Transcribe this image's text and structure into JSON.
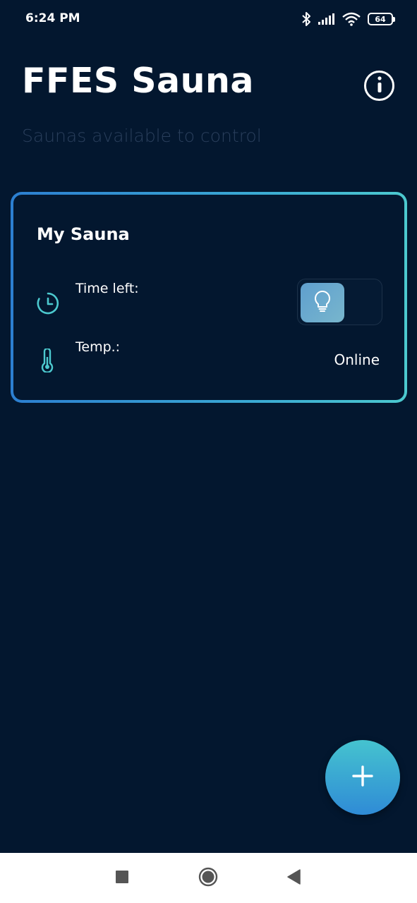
{
  "status_bar": {
    "time": "6:24 PM",
    "battery": "64",
    "icons": [
      "bluetooth-icon",
      "signal-icon",
      "wifi-icon",
      "battery-icon"
    ]
  },
  "header": {
    "title": "FFES Sauna",
    "subtitle": "Saunas available to control",
    "info_icon": "info-icon"
  },
  "sauna_card": {
    "name": "My Sauna",
    "time_left_label": "Time left:",
    "temp_label": "Temp.:",
    "status": "Online",
    "light_toggle_icon": "lightbulb-icon",
    "time_icon": "clock-icon",
    "temp_icon": "thermometer-icon"
  },
  "fab": {
    "icon": "plus-icon"
  },
  "nav_bar": {
    "items": [
      "recents-square-icon",
      "home-circle-icon",
      "back-triangle-icon"
    ]
  },
  "colors": {
    "background": "#03172f",
    "accent_start": "#2c7fd1",
    "accent_end": "#4cc9cf",
    "subtitle": "#2a3f5c",
    "icon_teal": "#4cc9cf"
  }
}
